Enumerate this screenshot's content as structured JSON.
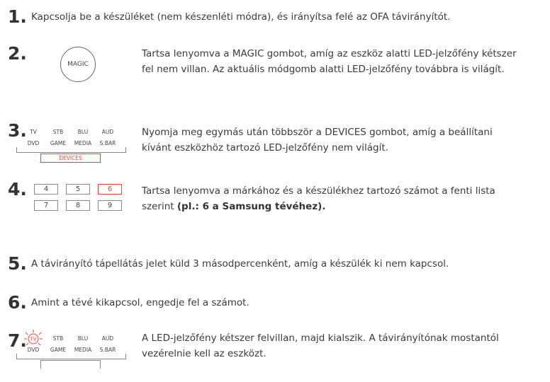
{
  "steps": [
    {
      "num": "1.",
      "text": "Kapcsolja be a készüléket (nem készenléti módra), és irányítsa felé az OFA távirányítót."
    },
    {
      "num": "2.",
      "line1": "Tartsa lenyomva a MAGIC gombot, amíg az eszköz alatti LED-jelzőfény kétszer",
      "line2": "fel nem villan. Az aktuális módgomb alatti LED-jelzőfény továbbra is világít."
    },
    {
      "num": "3.",
      "line1": "Nyomja meg egymás után többször a DEVICES gombot, amíg a beállítani",
      "line2": "kívánt eszközhöz tartozó LED-jelzőfény nem világít."
    },
    {
      "num": "4.",
      "line1": "Tartsa lenyomva a márkához és a készülékhez tartozó számot a fenti lista",
      "line2_plain": "szerint ",
      "line2_bold": "(pl.: 6 a Samsung tévéhez)."
    },
    {
      "num": "5.",
      "text": "A távirányító tápellátás jelet küld 3 másodpercenként, amíg a készülék ki nem kapcsol."
    },
    {
      "num": "6.",
      "text": "Amint a tévé kikapcsol, engedje fel a számot."
    },
    {
      "num": "7.",
      "line1": "A LED-jelzőfény kétszer felvillan, majd kialszik. A távirányítónak mostantól",
      "line2": "vezérelnie kell az eszközt."
    }
  ],
  "magic_label": "MAGIC",
  "devices_row1": [
    "TV",
    "STB",
    "BLU",
    "AUD"
  ],
  "devices_row2": [
    "DVD",
    "GAME",
    "MEDIA",
    "S.BAR"
  ],
  "devices_label": "DEVICES",
  "keypad": [
    "4",
    "5",
    "6",
    "7",
    "8",
    "9"
  ],
  "highlight_key": "6",
  "accent_color": "#e0463c"
}
